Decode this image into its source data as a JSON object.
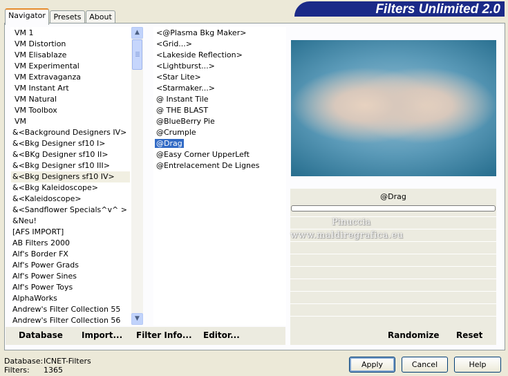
{
  "tabs": [
    {
      "label": "Navigator",
      "active": true
    },
    {
      "label": "Presets",
      "active": false
    },
    {
      "label": "About",
      "active": false
    }
  ],
  "banner": {
    "title": "Filters Unlimited 2.0"
  },
  "categories": [
    "VM 1",
    "VM Distortion",
    "VM Elisablaze",
    "VM Experimental",
    "VM Extravaganza",
    "VM Instant Art",
    "VM Natural",
    "VM Toolbox",
    "VM",
    "&<Background Designers IV>",
    "&<Bkg Designer sf10 I>",
    "&<BKg Designer sf10 II>",
    "&<Bkg Designer sf10 III>",
    "&<Bkg Designers sf10 IV>",
    "&<Bkg Kaleidoscope>",
    "&<Kaleidoscope>",
    "&<Sandflower Specials^v^ >",
    "&Neu!",
    "[AFS IMPORT]",
    "AB Filters 2000",
    "Alf's Border FX",
    "Alf's Power Grads",
    "Alf's Power Sines",
    "Alf's Power Toys",
    "AlphaWorks",
    "Andrew's Filter Collection 55",
    "Andrew's Filter Collection 56"
  ],
  "selected_category": "&<Bkg Designers sf10 IV>",
  "filters": [
    "<@Plasma Bkg Maker>",
    "<Grid...>",
    "<Lakeside Reflection>",
    "<Lightburst...>",
    "<Star Lite>",
    "<Starmaker...>",
    "@ Instant Tile",
    "@ THE BLAST",
    "@BlueBerry Pie",
    "@Crumple",
    "@Drag",
    "@Easy Corner UpperLeft",
    "@Entrelacement De Lignes"
  ],
  "selected_filter": "@Drag",
  "preview": {
    "filter_name": "@Drag"
  },
  "watermark": {
    "line1": "Pinuccia",
    "line2": "www.maldiregrafica.eu"
  },
  "toolbar": {
    "database": "Database",
    "import": "Import...",
    "filter_info": "Filter Info...",
    "editor": "Editor...",
    "randomize": "Randomize",
    "reset": "Reset"
  },
  "status": {
    "database_label": "Database:",
    "database_value": "ICNET-Filters",
    "filters_label": "Filters:",
    "filters_value": "1365"
  },
  "buttons": {
    "apply": "Apply",
    "cancel": "Cancel",
    "help": "Help"
  },
  "icons": {
    "scroll_up": "chevron-up-icon",
    "scroll_down": "chevron-down-icon"
  }
}
